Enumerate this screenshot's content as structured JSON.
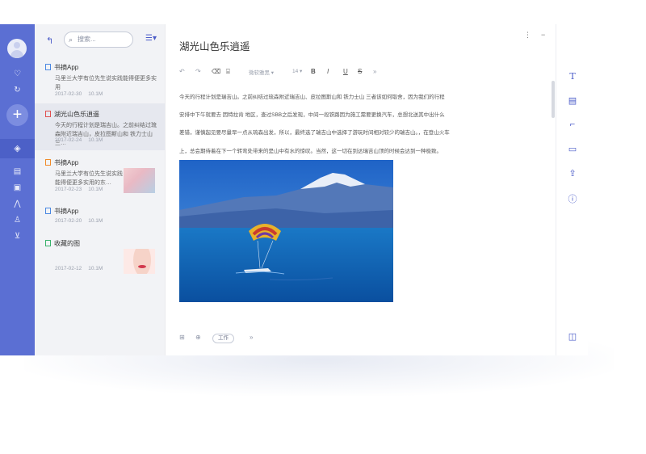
{
  "rail": {
    "add_label": "+"
  },
  "list": {
    "search_placeholder": "搜索...",
    "items": [
      {
        "title": "书摘App",
        "desc": "马里兰大学有位先生说实践能得便更多实用",
        "date": "2017-02-30",
        "size": "10.1M",
        "icon_color": "#4a88e2"
      },
      {
        "title": "湖光山色乐逍遥",
        "desc": "今天的行程计划是瑞吉山。之前纠结过琉森附近瑞吉山，皮拉图斯山和 铁力士山 三…",
        "date": "2017-02-24",
        "size": "10.1M",
        "icon_color": "#e05050"
      },
      {
        "title": "书摘App",
        "desc": "马里兰大学有位先生说实践能得便更多实用的东…",
        "date": "2017-02-23",
        "size": "10.1M",
        "icon_color": "#f08a2a"
      },
      {
        "title": "书摘App",
        "desc": "",
        "date": "2017-02-20",
        "size": "10.1M",
        "icon_color": "#4a88e2"
      },
      {
        "title": "收藏的图",
        "desc": "",
        "date": "2017-02-12",
        "size": "10.1M",
        "icon_color": "#38b26b"
      }
    ]
  },
  "editor": {
    "title": "湖光山色乐逍遥",
    "toolbar": {
      "undo": "↶",
      "redo": "↷",
      "font": "微软雅黑",
      "size": "14",
      "bold": "B",
      "italic": "I",
      "underline": "U",
      "strike": "S",
      "more": "»"
    },
    "body_lines": [
      "今天的行程计划是瑞吉山。之前纠结过琉森附近瑞吉山、皮拉图斯山和  铁力士山  三者该如何取舍，因为我们的行程",
      "安排中下午就要去  因特拉肯  地区，查过SBB之后发现，中间一段铁路因为施工需要更换汽车，总想北送其中出什么",
      "差错，谨慎起见要尽量早一点从琉森出发，所以，最终选了瑞吉山中选择了游玩时间相对较少的瑞吉山。，在登山火车",
      "上，总会期待着在下一个转弯处带来的是山中有水的惊叹。当然，这一切在到达瑞吉山顶的时候会达到一种极致。"
    ],
    "tag": "工作",
    "bottom_more": "»"
  },
  "window_controls": {
    "menu": "⋮",
    "minimize": "−",
    "maximize": "☐",
    "close": "✕"
  },
  "colors": {
    "rail": "#5b6fd3",
    "accent": "#4a5bc8",
    "list_bg": "#f2f3f6"
  }
}
